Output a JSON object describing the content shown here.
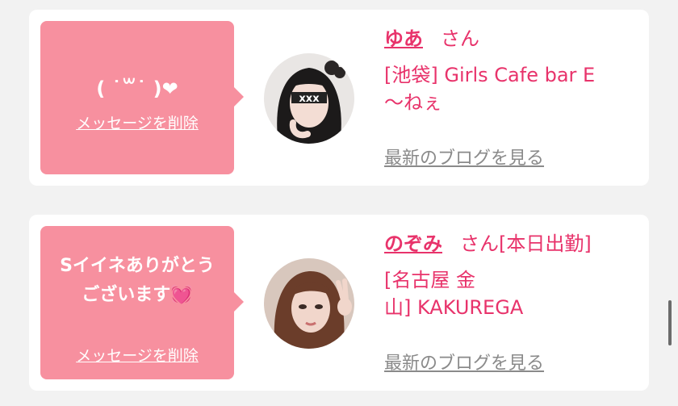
{
  "messages": [
    {
      "message_text": "( ˙꒳˙ )❤",
      "delete_label": "メッセージを削除",
      "name": "ゆあ",
      "suffix": "さん",
      "shop_line1": "[池袋] Girls Cafe bar E",
      "shop_line2": "〜ねぇ",
      "blog_label": "最新のブログを見る"
    },
    {
      "message_text": "Sイイネありがとうございます",
      "message_emoji": "💓",
      "delete_label": "メッセージを削除",
      "name": "のぞみ",
      "suffix": "さん[本日出勤]",
      "shop_line1": "[名古屋 金",
      "shop_line2": "山] KAKUREGA",
      "blog_label": "最新のブログを見る"
    }
  ],
  "colors": {
    "bubble": "#f7909f",
    "accent": "#e8336b",
    "muted": "#8a8a8a",
    "background": "#f2f2f2"
  }
}
